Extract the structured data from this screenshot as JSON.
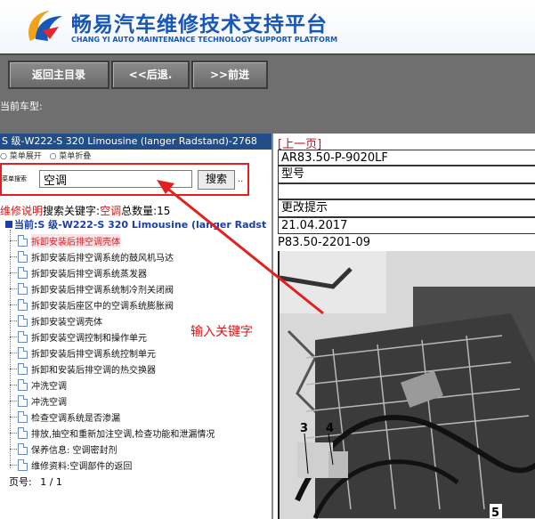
{
  "header": {
    "title": "畅易汽车维修技术支持平台",
    "subtitle": "CHANG YI AUTO MAINTENANCE TECHNOLOGY SUPPORT PLATFORM",
    "logo_icon": "cy-logo-icon"
  },
  "toolbar": {
    "main_menu": "返回主目录",
    "back": "<<后退.",
    "forward": ">>前进"
  },
  "current_model_label": "当前车型:",
  "left": {
    "car_title": "S 级-W222-S 320 Limousine (langer Radstand)-2768",
    "radio_options": [
      "○ 菜单展开",
      "○ 菜单折叠"
    ],
    "search_label": "菜单搜索",
    "search_value": "空调",
    "search_button": "搜索",
    "dots": "..",
    "info_prefix": "维修说明",
    "info_keyword_label": "搜索关键字:",
    "info_keyword": "空调",
    "info_count_label": "总数量:",
    "info_count": "15",
    "current_label": "当前:S 级-W222-S 320 Limousine (langer Radst",
    "items": [
      "拆卸安装后排空调壳体",
      "拆卸安装后排空调系统的鼓风机马达",
      "拆卸安装后排空调系统蒸发器",
      "拆卸安装后排空调系统制冷剂关闭阀",
      "拆卸安装后座区中的空调系统膨胀阀",
      "拆卸安装空调壳体",
      "拆卸安装空调控制和操作单元",
      "拆卸安装后排空调系统控制单元",
      "拆卸和安装后排空调的热交换器",
      "冲洗空调",
      "冲洗空调",
      "检查空调系统是否渗漏",
      "排放,抽空和重新加注空调,检查功能和泄漏情况",
      "保养信息: 空调密封剂",
      "维修资料:空调部件的返回"
    ],
    "pager_label": "页号:",
    "pager_value": "1 / 1"
  },
  "right": {
    "prev_page": "[上一页]",
    "fields": [
      "AR83.50-P-9020LF",
      "型号",
      "",
      "更改提示",
      "21.04.2017"
    ],
    "doc_code": "P83.50-2201-09",
    "callouts": [
      "3",
      "4",
      "5"
    ]
  },
  "annotation": "输入关键字",
  "colors": {
    "brand_blue": "#1657b8",
    "toolbar_gray": "#6f6f6f",
    "title_bar_blue": "#224d86",
    "highlight_red": "#e41f1f"
  }
}
